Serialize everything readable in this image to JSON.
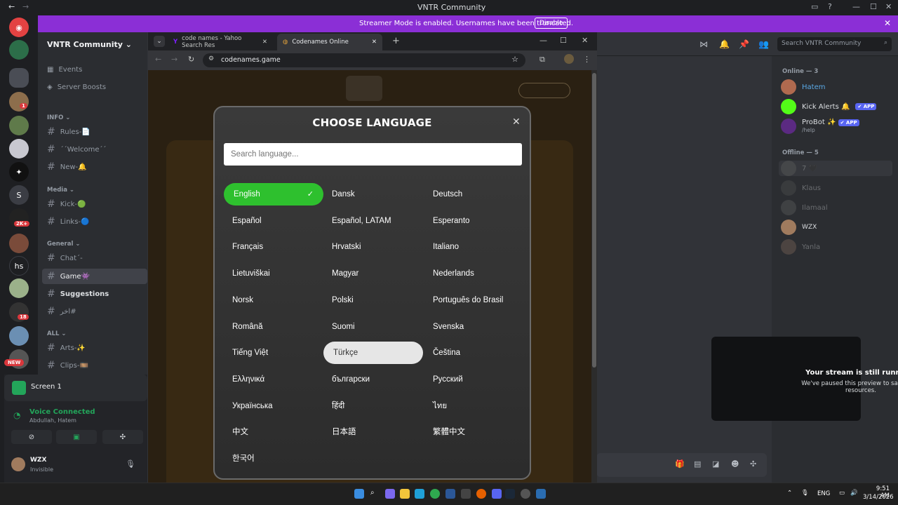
{
  "window": {
    "title": "VNTR Community"
  },
  "banner": {
    "text": "Streamer Mode is enabled. Usernames have been truncated.",
    "button": "Disable"
  },
  "rail": {
    "letters": [
      "S",
      "hs"
    ],
    "badges": [
      "1",
      "2K+",
      "18"
    ],
    "new_label": "NEW"
  },
  "sidebar": {
    "server_name": "VNTR Community",
    "top_items": [
      "Events",
      "Server Boosts"
    ],
    "categories": [
      {
        "name": "INFO",
        "channels": [
          "Rules-📄",
          "ˊˊWelcomeˊˊ",
          "New-🔔"
        ]
      },
      {
        "name": "Media",
        "channels": [
          "Kick-🟢",
          "Links-🔵"
        ]
      },
      {
        "name": "General",
        "channels": [
          "Chatˊ-",
          "Game👾",
          "Suggestions",
          "اخر#"
        ]
      },
      {
        "name": "ALL",
        "channels": [
          "Arts-✨",
          "Clips-🎞️"
        ]
      }
    ],
    "active_channel": "Game👾"
  },
  "voice": {
    "screen_label": "Screen 1",
    "status": "Voice Connected",
    "members": "Abdullah, Hatem",
    "user": "WZX",
    "user_status": "Invisible"
  },
  "topbar": {
    "search_placeholder": "Search VNTR Community"
  },
  "members": {
    "online_header": "Online — 3",
    "online": [
      {
        "name": "Hatem",
        "color": "#5aa9e6"
      },
      {
        "name": "Kick Alerts 🔔",
        "tag": "✔ APP"
      },
      {
        "name": "ProBot ✨",
        "tag": "✔ APP",
        "sub": "/help"
      }
    ],
    "offline_header": "Offline — 5",
    "offline": [
      "7 🖤",
      "Klaus",
      "Ilamaal",
      "WZX",
      "Yanla"
    ]
  },
  "stream_notice": {
    "title": "Your stream is still running!",
    "subtitle": "We've paused this preview to save your resources."
  },
  "browser": {
    "tabs": [
      {
        "label": "code names - Yahoo Search Res"
      },
      {
        "label": "Codenames Online"
      }
    ],
    "url": "codenames.game"
  },
  "dialog": {
    "title": "CHOOSE LANGUAGE",
    "search_placeholder": "Search language...",
    "selected": "English",
    "hovered": "Türkçe",
    "languages": [
      "English",
      "Dansk",
      "Deutsch",
      "Español",
      "Español, LATAM",
      "Esperanto",
      "Français",
      "Hrvatski",
      "Italiano",
      "Lietuviškai",
      "Magyar",
      "Nederlands",
      "Norsk",
      "Polski",
      "Português do Brasil",
      "Română",
      "Suomi",
      "Svenska",
      "Tiếng Việt",
      "Türkçe",
      "Čeština",
      "Ελληνικά",
      "български",
      "Русский",
      "Українська",
      "हिंदी",
      "ไทย",
      "中文",
      "日本語",
      "繁體中文",
      "한국어"
    ]
  },
  "taskbar": {
    "lang": "ENG",
    "time": "9:51 AM",
    "date": "3/14/2026"
  }
}
